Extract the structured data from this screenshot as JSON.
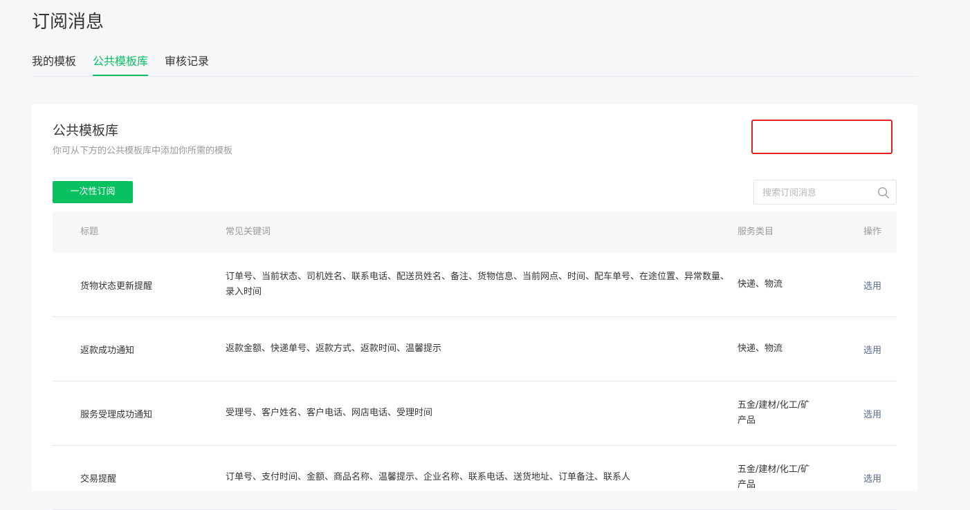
{
  "page": {
    "title": "订阅消息"
  },
  "tabs": [
    {
      "label": "我的模板",
      "active": false
    },
    {
      "label": "公共模板库",
      "active": true
    },
    {
      "label": "审核记录",
      "active": false
    }
  ],
  "card": {
    "title": "公共模板库",
    "description": "你可从下方的公共模板库中添加你所需的模板",
    "primary_button": "一次性订阅",
    "search_placeholder": "搜索订阅消息"
  },
  "table": {
    "headers": {
      "title": "标题",
      "keywords": "常见关键词",
      "category": "服务类目",
      "action": "操作"
    },
    "rows": [
      {
        "title": "货物状态更新提醒",
        "keywords": "订单号、当前状态、司机姓名、联系电话、配送员姓名、备注、货物信息、当前网点、时间、配车单号、在途位置、异常数量、录入时间",
        "category": "快递、物流",
        "action": "选用"
      },
      {
        "title": "返款成功通知",
        "keywords": "返款金额、快递单号、返款方式、返款时间、温馨提示",
        "category": "快递、物流",
        "action": "选用"
      },
      {
        "title": "服务受理成功通知",
        "keywords": "受理号、客户姓名、客户电话、网店电话、受理时间",
        "category": "五金/建材/化工/矿产品",
        "action": "选用"
      },
      {
        "title": "交易提醒",
        "keywords": "订单号、支付时间、金额、商品名称、温馨提示、企业名称、联系电话、送货地址、订单备注、联系人",
        "category": "五金/建材/化工/矿产品",
        "action": "选用"
      }
    ]
  },
  "colors": {
    "accent": "#07c160",
    "link": "#576b95",
    "highlight_box": "#e0201e"
  }
}
